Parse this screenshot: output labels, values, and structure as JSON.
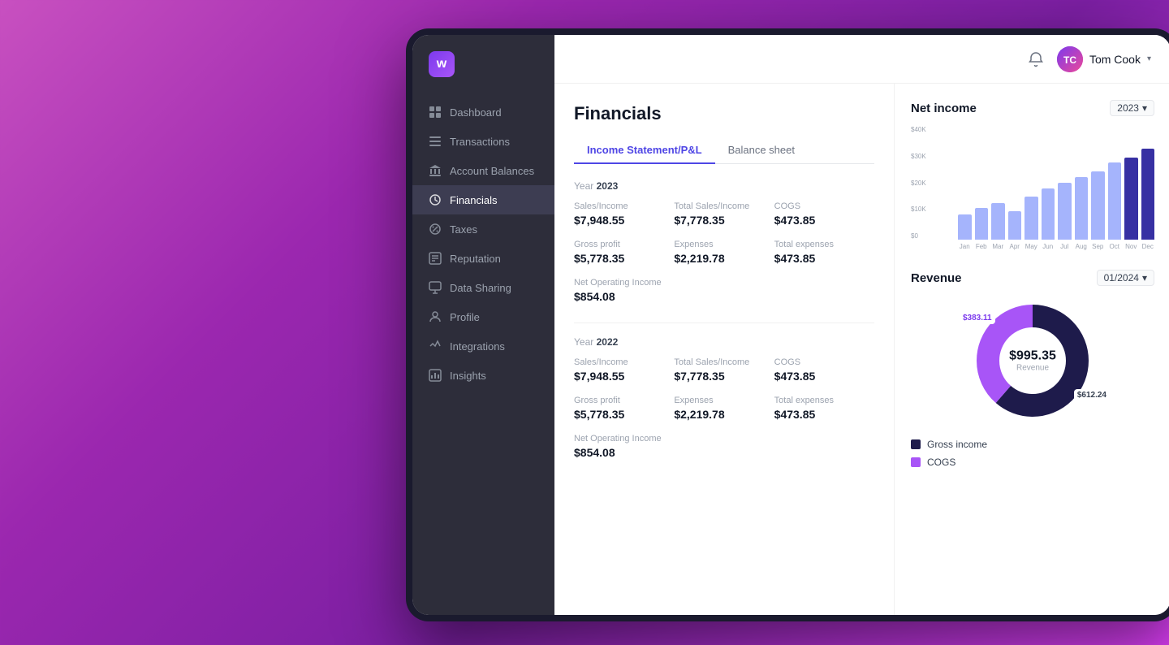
{
  "background": "linear-gradient(135deg, #c850c0, #9b27af, #7b1fa2, #e040fb)",
  "app": {
    "logo_text": "w",
    "header": {
      "user_name": "Tom Cook",
      "user_initials": "TC",
      "chevron": "▾"
    }
  },
  "sidebar": {
    "items": [
      {
        "id": "dashboard",
        "label": "Dashboard",
        "icon": "grid"
      },
      {
        "id": "transactions",
        "label": "Transactions",
        "icon": "list"
      },
      {
        "id": "account-balances",
        "label": "Account Balances",
        "icon": "bank"
      },
      {
        "id": "financials",
        "label": "Financials",
        "icon": "financials",
        "active": true
      },
      {
        "id": "taxes",
        "label": "Taxes",
        "icon": "taxes"
      },
      {
        "id": "reputation",
        "label": "Reputation",
        "icon": "reputation"
      },
      {
        "id": "data-sharing",
        "label": "Data Sharing",
        "icon": "data"
      },
      {
        "id": "profile",
        "label": "Profile",
        "icon": "profile"
      },
      {
        "id": "integrations",
        "label": "Integrations",
        "icon": "integrations"
      },
      {
        "id": "insights",
        "label": "Insights",
        "icon": "insights"
      }
    ]
  },
  "page": {
    "title": "Financials",
    "tabs": [
      {
        "id": "income-statement",
        "label": "Income Statement/P&L",
        "active": true
      },
      {
        "id": "balance-sheet",
        "label": "Balance sheet",
        "active": false
      }
    ],
    "year_2023": {
      "year": "2023",
      "sales_income_label": "Sales/Income",
      "sales_income_value": "$7,948.55",
      "total_sales_label": "Total Sales/Income",
      "total_sales_value": "$7,778.35",
      "cogs_label": "COGS",
      "cogs_value": "$473.85",
      "gross_profit_label": "Gross profit",
      "gross_profit_value": "$5,778.35",
      "expenses_label": "Expenses",
      "expenses_value": "$2,219.78",
      "total_expenses_label": "Total expenses",
      "total_expenses_value": "$473.85",
      "net_operating_label": "Net Operating Income",
      "net_operating_value": "$854.08"
    },
    "year_2022": {
      "year": "2022",
      "sales_income_label": "Sales/Income",
      "sales_income_value": "$7,948.55",
      "total_sales_label": "Total Sales/Income",
      "total_sales_value": "$7,778.35",
      "cogs_label": "COGS",
      "cogs_value": "$473.85",
      "gross_profit_label": "Gross profit",
      "gross_profit_value": "$5,778.35",
      "expenses_label": "Expenses",
      "expenses_value": "$2,219.78",
      "total_expenses_label": "Total expenses",
      "total_expenses_value": "$473.85",
      "net_operating_label": "Net Operating Income",
      "net_operating_value": "$854.08"
    }
  },
  "net_income_chart": {
    "title": "Net income",
    "filter": "2023",
    "y_labels": [
      "$40K",
      "$30K",
      "$20K",
      "$10K",
      "$0"
    ],
    "bars": [
      {
        "month": "Jan",
        "height_pct": 22,
        "highlight": false
      },
      {
        "month": "Feb",
        "height_pct": 28,
        "highlight": false
      },
      {
        "month": "Mar",
        "height_pct": 32,
        "highlight": false
      },
      {
        "month": "Apr",
        "height_pct": 25,
        "highlight": false
      },
      {
        "month": "May",
        "height_pct": 38,
        "highlight": false
      },
      {
        "month": "Jun",
        "height_pct": 45,
        "highlight": false
      },
      {
        "month": "Jul",
        "height_pct": 50,
        "highlight": false
      },
      {
        "month": "Aug",
        "height_pct": 55,
        "highlight": false
      },
      {
        "month": "Sep",
        "height_pct": 60,
        "highlight": false
      },
      {
        "month": "Oct",
        "height_pct": 68,
        "highlight": false
      },
      {
        "month": "Nov",
        "height_pct": 72,
        "highlight": true
      },
      {
        "month": "Dec",
        "height_pct": 80,
        "highlight": true
      }
    ]
  },
  "revenue_chart": {
    "title": "Revenue",
    "filter": "01/2024",
    "center_value": "$995.35",
    "center_label": "Revenue",
    "label_383": "$383.11",
    "label_612": "$612.24",
    "segments": [
      {
        "label": "Gross income",
        "color": "#1e1b4b",
        "value": 612.24
      },
      {
        "label": "COGS",
        "color": "#a855f7",
        "value": 383.11
      }
    ],
    "legend": [
      {
        "label": "Gross income",
        "color": "#1e1b4b"
      },
      {
        "label": "COGS",
        "color": "#a855f7"
      }
    ]
  }
}
